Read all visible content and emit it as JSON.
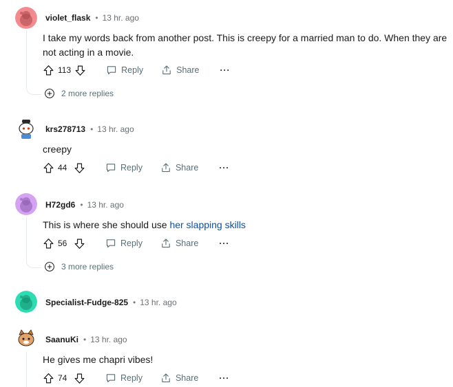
{
  "comments": [
    {
      "username": "violet_flask",
      "time": "13 hr. ago",
      "text": "I take my words back from another post. This is creepy for a married man to do. When they are not acting in a movie.",
      "score": "113",
      "reply": "Reply",
      "share": "Share",
      "more": "···",
      "more_replies": "2 more replies",
      "avatar_color": "#f28a8f"
    },
    {
      "username": "krs278713",
      "time": "13 hr. ago",
      "text": "creepy",
      "score": "44",
      "reply": "Reply",
      "share": "Share",
      "more": "···"
    },
    {
      "username": "H72gd6",
      "time": "13 hr. ago",
      "text_prefix": "This is where she should use ",
      "text_link": "her slapping skills",
      "score": "56",
      "reply": "Reply",
      "share": "Share",
      "more": "···",
      "more_replies": "3 more replies",
      "avatar_color": "#d5a3f1"
    },
    {
      "username": "Specialist-Fudge-825",
      "time": "13 hr. ago",
      "avatar_color": "#2fdcb2"
    },
    {
      "username": "SaanuKi",
      "time": "13 hr. ago",
      "text": "He gives me chapri vibes!",
      "score": "74",
      "reply": "Reply",
      "share": "Share",
      "more": "···"
    }
  ],
  "icons": {
    "upvote": "upvote-arrow-icon",
    "downvote": "downvote-arrow-icon",
    "reply": "speech-bubble-icon",
    "share": "share-upload-icon",
    "more": "ellipsis-icon",
    "expand": "plus-circle-icon"
  },
  "colors": {
    "link": "#0b4eaa",
    "muted": "#576f76",
    "thread_line": "#e5ebee"
  }
}
